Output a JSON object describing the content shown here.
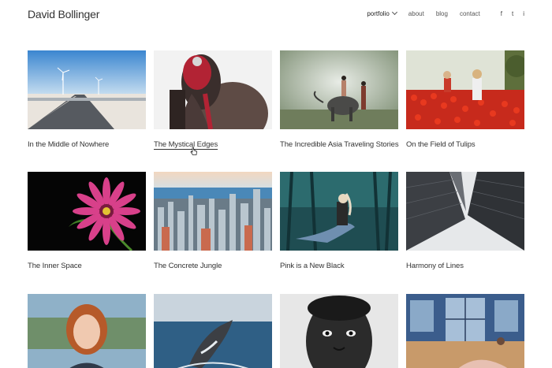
{
  "header": {
    "brand": "David Bollinger",
    "nav": [
      {
        "label": "portfolio",
        "active": true
      },
      {
        "label": "about"
      },
      {
        "label": "blog"
      },
      {
        "label": "contact"
      }
    ],
    "social": [
      "f",
      "t",
      "i"
    ]
  },
  "portfolio": [
    {
      "title": "In the Middle of Nowhere"
    },
    {
      "title": "The Mystical Edges"
    },
    {
      "title": "The Incredible Asia Traveling Stories"
    },
    {
      "title": "On the Field of Tulips"
    },
    {
      "title": "The Inner Space"
    },
    {
      "title": "The Concrete Jungle"
    },
    {
      "title": "Pink is a New Black"
    },
    {
      "title": "Harmony of Lines"
    },
    {
      "title": ""
    },
    {
      "title": ""
    },
    {
      "title": ""
    },
    {
      "title": ""
    }
  ]
}
